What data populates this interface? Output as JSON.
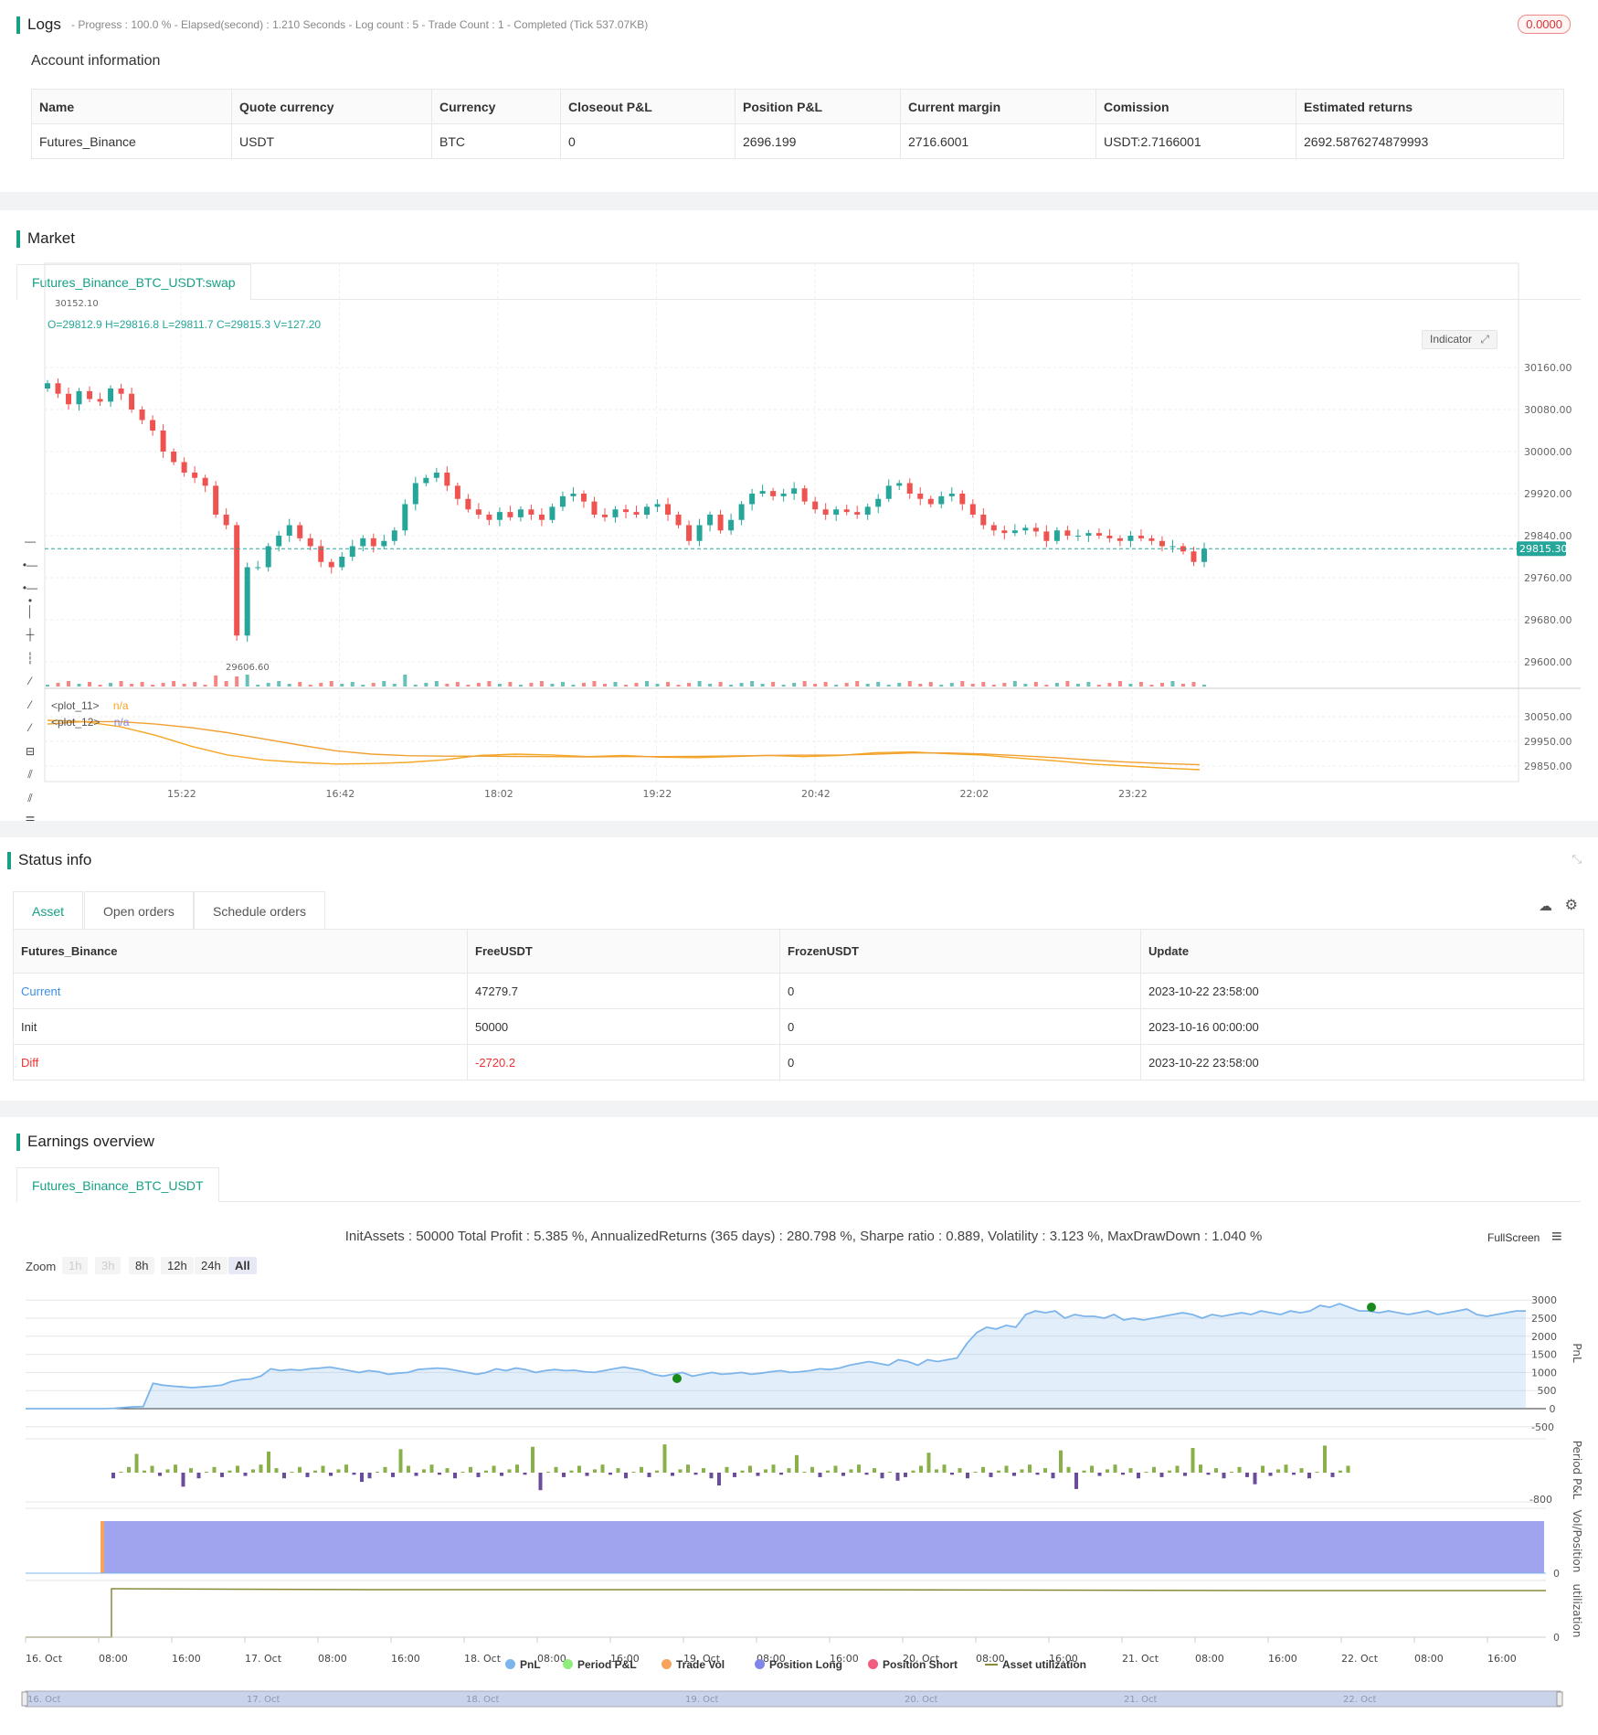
{
  "logs": {
    "title": "Logs",
    "meta": "- Progress : 100.0 % - Elapsed(second) : 1.210  Seconds - Log count : 5 - Trade Count : 1 - Completed (Tick 537.07KB)",
    "badge": "0.0000"
  },
  "account": {
    "title": "Account information",
    "headers": [
      "Name",
      "Quote currency",
      "Currency",
      "Closeout P&L",
      "Position P&L",
      "Current margin",
      "Comission",
      "Estimated returns"
    ],
    "row": [
      "Futures_Binance",
      "USDT",
      "BTC",
      "0",
      "2696.199",
      "2716.6001",
      "USDT:2.7166001",
      "2692.5876274879993"
    ]
  },
  "market": {
    "title": "Market",
    "tab": "Futures_Binance_BTC_USDT:swap",
    "ohlc": "O=29812.9 H=29816.8 L=29811.7 C=29815.3 V=127.20",
    "indicator_btn": "Indicator",
    "high_label": "30152.10",
    "low_label": "29606.60",
    "price_tag": "29815.30",
    "price_ticks": [
      "30160.00",
      "30080.00",
      "30000.00",
      "29920.00",
      "29840.00",
      "29760.00",
      "29680.00",
      "29600.00"
    ],
    "ind_ticks": [
      "30050.00",
      "29950.00",
      "29850.00"
    ],
    "time_ticks": [
      "15:22",
      "16:42",
      "18:02",
      "19:22",
      "20:42",
      "22:02",
      "23:22"
    ],
    "plot11": "<plot_11>",
    "plot12": "<plot_12>",
    "na": "n/a",
    "colors": {
      "up": "#26a69a",
      "down": "#ef5350",
      "plot11": "#f5a623",
      "plot12": "#f0a030"
    }
  },
  "chart_data": {
    "type": "line",
    "title": "",
    "series": [
      {
        "name": "<plot_11>",
        "values": [
          30035,
          30030,
          30010,
          29975,
          29930,
          29895,
          29875,
          29865,
          29858,
          29860,
          29865,
          29875,
          29893,
          29898,
          29895,
          29888,
          29893,
          29886,
          29884,
          29888,
          29893,
          29888,
          29893,
          29904,
          29907,
          29900,
          29894,
          29882,
          29871,
          29858,
          29850,
          29842,
          29835
        ]
      },
      {
        "name": "<plot_12>",
        "values": [
          30020,
          30030,
          30030,
          30020,
          30005,
          29985,
          29960,
          29935,
          29912,
          29898,
          29892,
          29890,
          29890,
          29889,
          29888,
          29887,
          29888,
          29888,
          29889,
          29891,
          29893,
          29894,
          29894,
          29898,
          29903,
          29903,
          29899,
          29892,
          29884,
          29874,
          29866,
          29860,
          29855
        ]
      }
    ],
    "x": [
      "15:22",
      "16:42",
      "18:02",
      "19:22",
      "20:42",
      "22:02",
      "23:22"
    ]
  },
  "status": {
    "title": "Status info",
    "tabs": [
      "Asset",
      "Open orders",
      "Schedule orders"
    ],
    "headers": [
      "Futures_Binance",
      "FreeUSDT",
      "FrozenUSDT",
      "Update"
    ],
    "rows": [
      [
        "Current",
        "47279.7",
        "0",
        "2023-10-22 23:58:00"
      ],
      [
        "Init",
        "50000",
        "0",
        "2023-10-16 00:00:00"
      ],
      [
        "Diff",
        "-2720.2",
        "0",
        "2023-10-22 23:58:00"
      ]
    ]
  },
  "earnings": {
    "title": "Earnings overview",
    "tab": "Futures_Binance_BTC_USDT",
    "summary": "InitAssets : 50000 Total Profit : 5.385 %, AnnualizedReturns (365 days) : 280.798 %, Sharpe ratio : 0.889, Volatility : 3.123 %, MaxDrawDown : 1.040 %",
    "fullscreen": "FullScreen",
    "zoom_label": "Zoom",
    "zoom_btns": [
      "1h",
      "3h",
      "8h",
      "12h",
      "24h",
      "All"
    ],
    "pnl_ticks": [
      "3000",
      "2500",
      "2000",
      "1500",
      "1000",
      "500",
      "0",
      "-500"
    ],
    "period_tick": "-800",
    "vol_tick": "0",
    "util_tick": "0",
    "axis_labels": [
      "PnL",
      "Period P&L",
      "Vol/Position",
      "utilization"
    ],
    "x_ticks": [
      "16. Oct",
      "08:00",
      "16:00",
      "17. Oct",
      "08:00",
      "16:00",
      "18. Oct",
      "08:00",
      "16:00",
      "19. Oct",
      "08:00",
      "16:00",
      "20. Oct",
      "08:00",
      "16:00",
      "21. Oct",
      "08:00",
      "16:00",
      "22. Oct",
      "08:00",
      "16:00"
    ],
    "nav_labels": [
      "16. Oct",
      "17. Oct",
      "18. Oct",
      "19. Oct",
      "20. Oct",
      "21. Oct",
      "22. Oct"
    ],
    "legend": [
      {
        "name": "PnL",
        "color": "#7cb5ec"
      },
      {
        "name": "Period P&L",
        "color": "#90ed7d"
      },
      {
        "name": "Trade Vol",
        "color": "#f7a35c"
      },
      {
        "name": "Position Long",
        "color": "#8085e9"
      },
      {
        "name": "Position Short",
        "color": "#f15c80"
      },
      {
        "name": "Asset utilization",
        "color": "#8a8a3a"
      }
    ]
  }
}
